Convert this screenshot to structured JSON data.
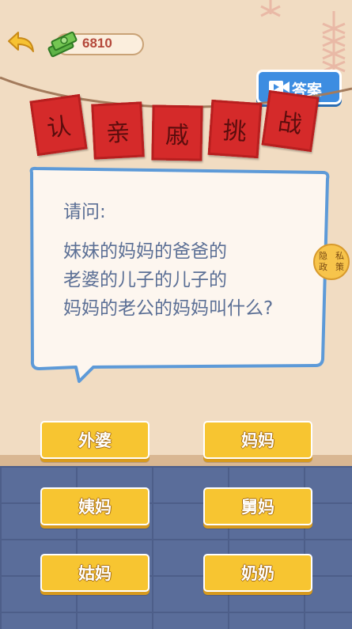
{
  "header": {
    "coins": "6810",
    "answer_label": "答案"
  },
  "banner": {
    "chars": [
      "认",
      "亲",
      "戚",
      "挑",
      "战"
    ]
  },
  "question": {
    "intro": "请问:",
    "lines": [
      "妹妹的妈妈的爸爸的",
      "老婆的儿子的儿子的",
      "妈妈的老公的妈妈叫什么?"
    ]
  },
  "privacy": {
    "chars": [
      "隐",
      "私",
      "政",
      "策"
    ]
  },
  "options": [
    "外婆",
    "妈妈",
    "姨妈",
    "舅妈",
    "姑妈",
    "奶奶"
  ],
  "colors": {
    "option_fill": "#f7c531",
    "answer_button": "#3d8de1",
    "flag_red": "#d52a2a",
    "question_text": "#5b6f95"
  }
}
